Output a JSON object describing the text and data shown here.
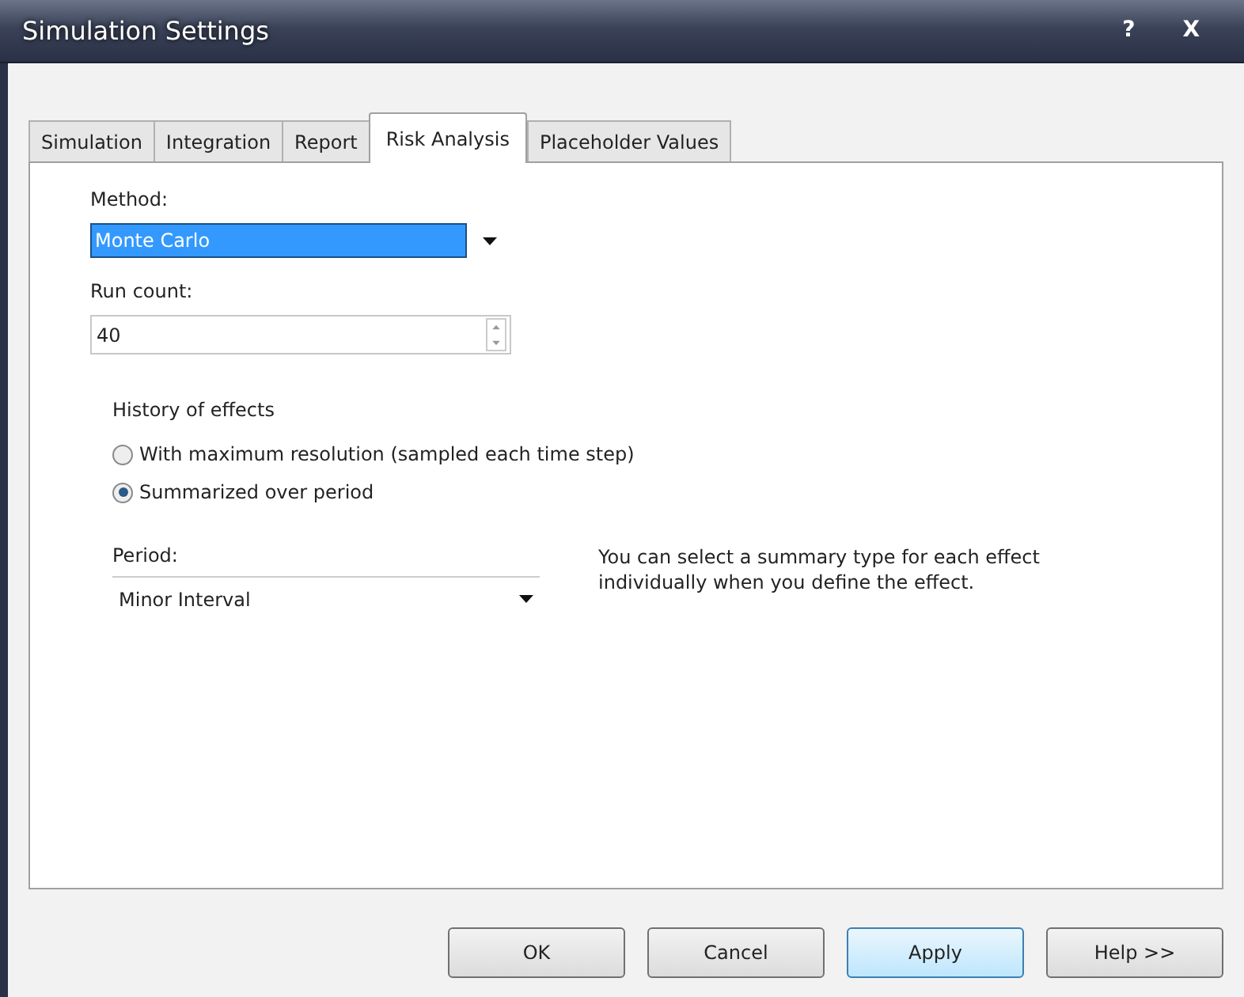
{
  "window": {
    "title": "Simulation Settings",
    "help_button": "?",
    "close_button": "X"
  },
  "tabs": [
    {
      "label": "Simulation",
      "selected": false
    },
    {
      "label": "Integration",
      "selected": false
    },
    {
      "label": "Report",
      "selected": false
    },
    {
      "label": "Risk Analysis",
      "selected": true
    },
    {
      "label": "Placeholder Values",
      "selected": false
    }
  ],
  "method": {
    "label": "Method:",
    "value": "Monte Carlo",
    "focused": true
  },
  "run_count": {
    "label": "Run count:",
    "value": "40"
  },
  "history": {
    "label": "History of effects",
    "options": [
      {
        "label": "With maximum resolution (sampled each time step)",
        "selected": false
      },
      {
        "label": "Summarized over period",
        "selected": true
      }
    ]
  },
  "period": {
    "label": "Period:",
    "value": "Minor Interval"
  },
  "note": "You can select a summary type for each effect individually when you define the effect.",
  "buttons": [
    {
      "label": "OK",
      "default": false
    },
    {
      "label": "Cancel",
      "default": false
    },
    {
      "label": "Apply",
      "default": true
    },
    {
      "label": "Help >>",
      "default": false
    }
  ]
}
